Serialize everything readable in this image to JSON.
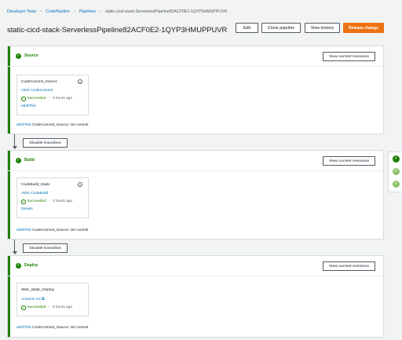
{
  "breadcrumb": {
    "items": [
      "Developer Tools",
      "CodePipeline",
      "Pipelines"
    ],
    "current": "static-cicd-stack-ServerlessPipeline82ACF0E2-1QYP3HMUPPUVR",
    "separator": "›"
  },
  "header": {
    "title": "static-cicd-stack-ServerlessPipeline82ACF0E2-1QYP3HMUPPUVR",
    "buttons": {
      "edit": "Edit",
      "clone": "Clone pipeline",
      "history": "View history",
      "release": "Release change"
    }
  },
  "stages": [
    {
      "name": "Source",
      "button": "View current revisions",
      "action": {
        "name": "CodeCommit_Source",
        "provider": "AWS CodeCommit",
        "status": "Succeeded",
        "time": "3 hours ago",
        "link": "e83f7feb"
      },
      "commit": {
        "id": "e83f7feb",
        "text": "CodeCommit_Source: init commit"
      }
    },
    {
      "name": "Build",
      "button": "View current revisions",
      "action": {
        "name": "CodeBuild_Static",
        "provider": "AWS CodeBuild",
        "status": "Succeeded",
        "time": "3 hours ago",
        "link": "Details"
      },
      "commit": {
        "id": "e83f7feb",
        "text": "CodeCommit_Source: init commit"
      }
    },
    {
      "name": "Deploy",
      "button": "View current revisions",
      "action": {
        "name": "Web_Static_Deploy",
        "provider": "Amazon S3",
        "status": "Succeeded",
        "time": "3 hours ago"
      },
      "commit": {
        "id": "e83f7feb",
        "text": "CodeCommit_Source: init commit"
      }
    }
  ],
  "transitions": [
    "Disable transition",
    "Disable transition"
  ],
  "icons": {
    "check": "✓",
    "info": "i",
    "external_link": "⧉"
  },
  "colors": {
    "success": "#1d8102",
    "success_light": "#8ec36b",
    "accent": "#ec7211",
    "link": "#0073bb"
  }
}
